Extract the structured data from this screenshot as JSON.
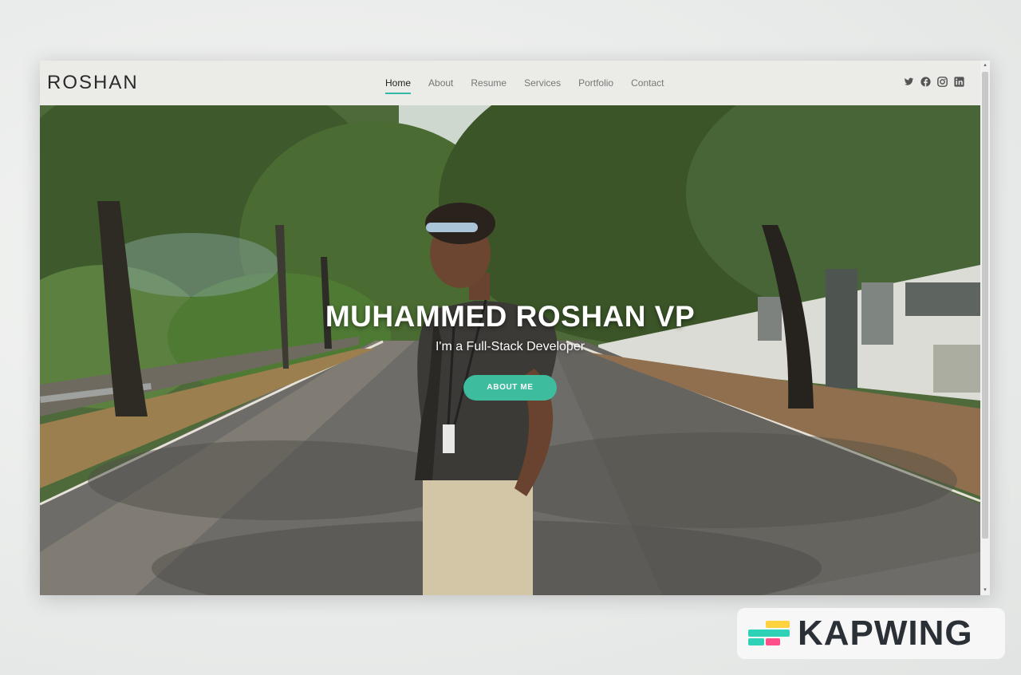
{
  "navbar": {
    "brand": "ROSHAN",
    "links": [
      {
        "label": "Home",
        "active": true
      },
      {
        "label": "About"
      },
      {
        "label": "Resume"
      },
      {
        "label": "Services"
      },
      {
        "label": "Portfolio"
      },
      {
        "label": "Contact"
      }
    ],
    "socials": [
      "twitter-icon",
      "facebook-icon",
      "instagram-icon",
      "linkedin-icon"
    ],
    "accent_color": "#34b7a7"
  },
  "hero": {
    "title": "MUHAMMED ROSHAN VP",
    "subtitle": "I'm a Full-Stack Developer",
    "button_label": "ABOUT ME",
    "button_color": "#3dbd9e"
  },
  "watermark": {
    "text": "KAPWING"
  }
}
